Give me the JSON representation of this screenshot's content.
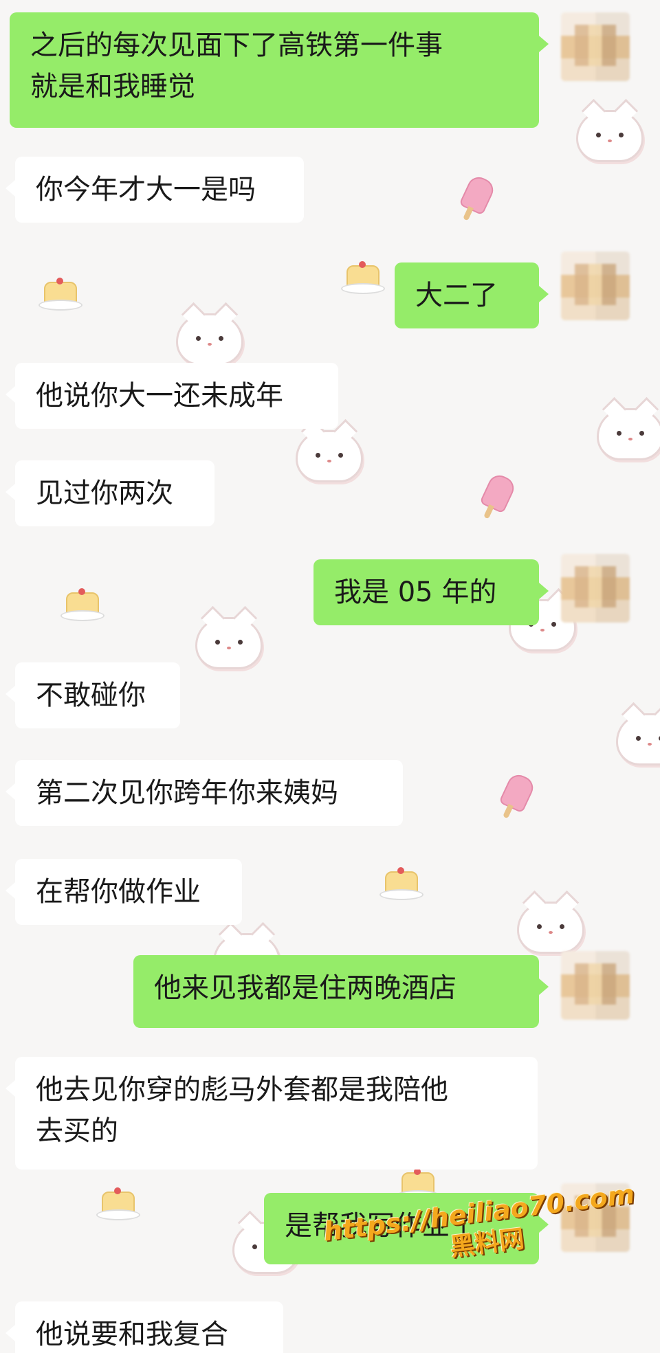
{
  "messages": [
    {
      "side": "right",
      "text": "之后的每次见面下了高铁第一件事\n就是和我睡觉"
    },
    {
      "side": "left",
      "text": "你今年才大一是吗"
    },
    {
      "side": "right",
      "text": "大二了"
    },
    {
      "side": "left",
      "text": "他说你大一还未成年"
    },
    {
      "side": "left",
      "text": "见过你两次"
    },
    {
      "side": "right",
      "text": "我是 05 年的"
    },
    {
      "side": "left",
      "text": "不敢碰你"
    },
    {
      "side": "left",
      "text": "第二次见你跨年你来姨妈"
    },
    {
      "side": "left",
      "text": "在帮你做作业"
    },
    {
      "side": "right",
      "text": "他来见我都是住两晚酒店"
    },
    {
      "side": "left",
      "text": "他去见你穿的彪马外套都是我陪他\n去买的"
    },
    {
      "side": "right",
      "text": "是帮我写作业了"
    },
    {
      "side": "left",
      "text": "他说要和我复合"
    }
  ],
  "watermark": {
    "url": "https://heiliao70.com",
    "site_name": "黑料网"
  }
}
